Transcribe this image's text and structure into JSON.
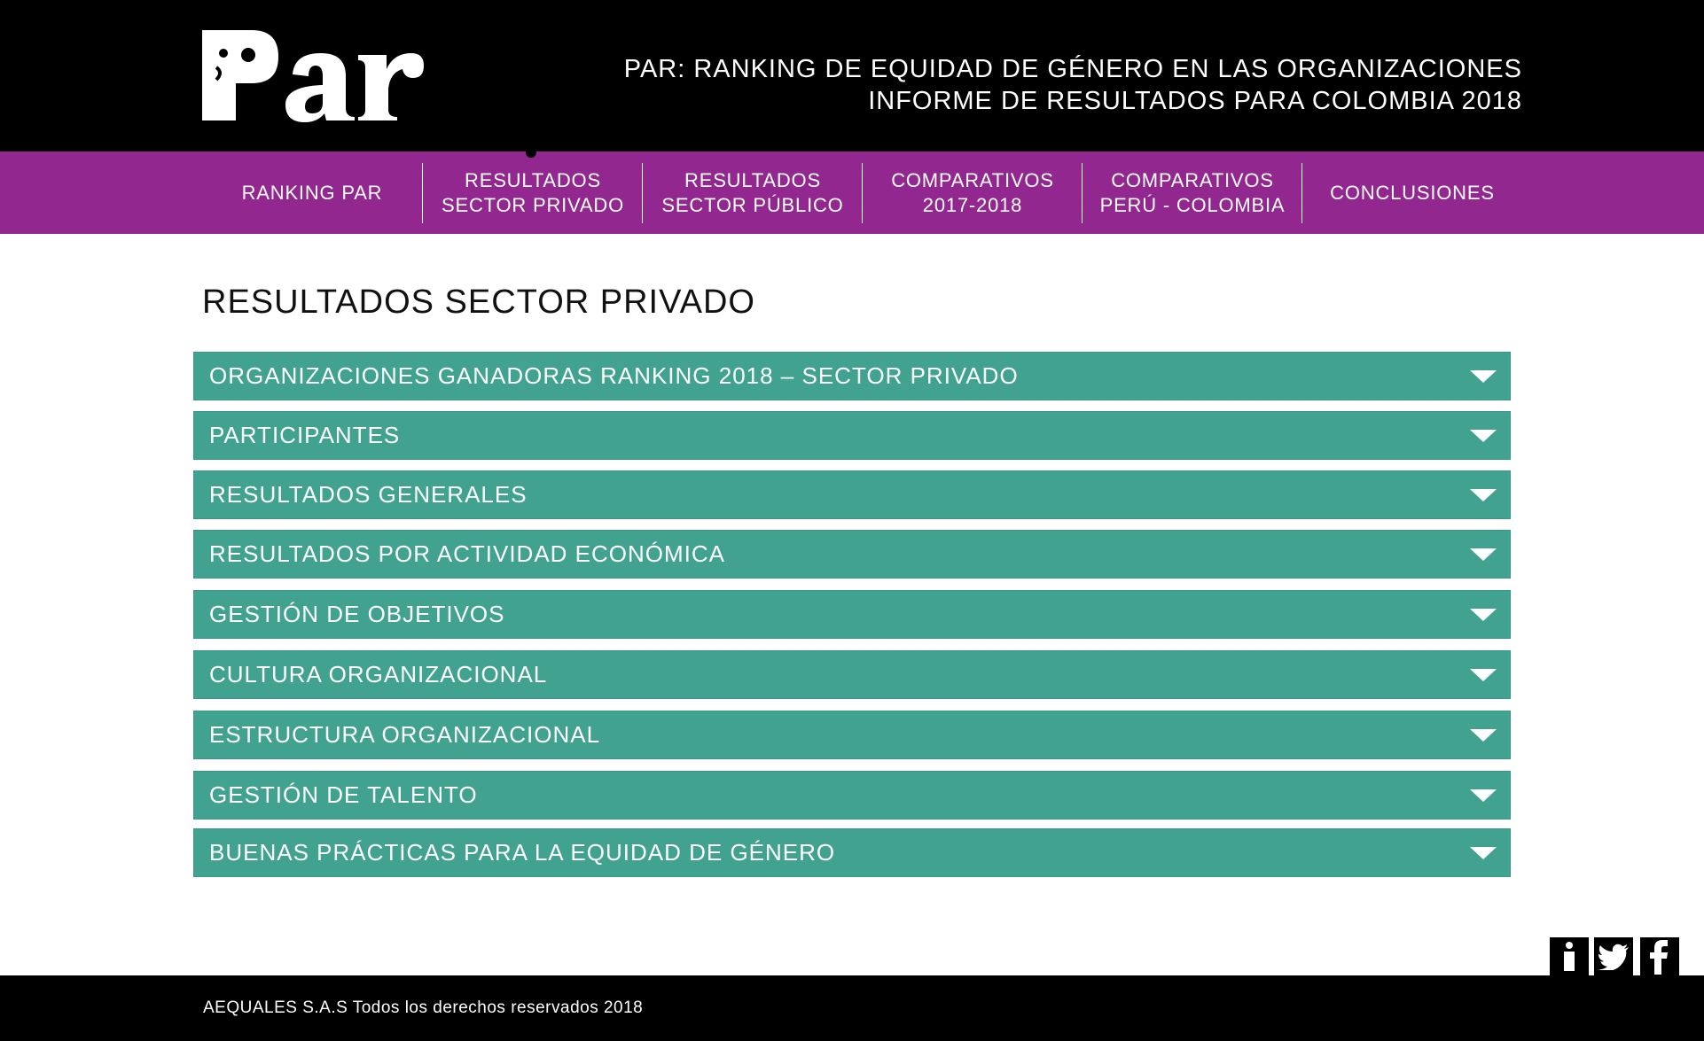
{
  "header": {
    "logo_text": "Par",
    "title_line1": "PAR: RANKING DE EQUIDAD DE GÉNERO EN LAS ORGANIZACIONES",
    "title_line2": "INFORME DE RESULTADOS PARA COLOMBIA 2018"
  },
  "nav": {
    "items": [
      {
        "label": "RANKING PAR"
      },
      {
        "label": "RESULTADOS\nSECTOR PRIVADO"
      },
      {
        "label": "RESULTADOS\nSECTOR PÚBLICO"
      },
      {
        "label": "COMPARATIVOS\n2017-2018"
      },
      {
        "label": "COMPARATIVOS\nPERÚ - COLOMBIA"
      },
      {
        "label": "CONCLUSIONES"
      }
    ]
  },
  "main": {
    "title": "RESULTADOS SECTOR PRIVADO",
    "sections": [
      {
        "label": "ORGANIZACIONES GANADORAS RANKING 2018 – SECTOR PRIVADO"
      },
      {
        "label": "PARTICIPANTES"
      },
      {
        "label": "RESULTADOS GENERALES"
      },
      {
        "label": "RESULTADOS POR ACTIVIDAD ECONÓMICA"
      },
      {
        "label": "GESTIÓN DE OBJETIVOS"
      },
      {
        "label": "CULTURA ORGANIZACIONAL"
      },
      {
        "label": "ESTRUCTURA ORGANIZACIONAL"
      },
      {
        "label": "GESTIÓN DE TALENTO"
      },
      {
        "label": "BUENAS PRÁCTICAS PARA LA EQUIDAD DE GÉNERO"
      }
    ]
  },
  "social": {
    "icons": [
      "info-icon",
      "twitter-icon",
      "facebook-icon"
    ]
  },
  "footer": {
    "text": "AEQUALES  S.A.S Todos los derechos reservados 2018"
  },
  "colors": {
    "header_bg": "#000000",
    "nav_bg": "#92278f",
    "accordion_bg": "#41a28f",
    "text_light": "#ffffff"
  }
}
